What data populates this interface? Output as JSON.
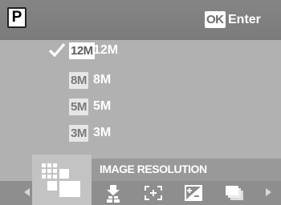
{
  "header": {
    "mode": "P",
    "ok_key": "OK",
    "ok_action": "Enter"
  },
  "resolution_options": [
    {
      "icon_text": "12M",
      "label": "12M",
      "selected": true
    },
    {
      "icon_text": "8M",
      "label": "8M",
      "selected": false
    },
    {
      "icon_text": "5M",
      "label": "5M",
      "selected": false
    },
    {
      "icon_text": "3M",
      "label": "3M",
      "selected": false
    }
  ],
  "menu": {
    "title": "IMAGE RESOLUTION",
    "icons": [
      "image-resolution-icon",
      "image-quality-icon",
      "focus-area-icon",
      "exposure-compensation-icon",
      "drive-mode-icon"
    ]
  }
}
